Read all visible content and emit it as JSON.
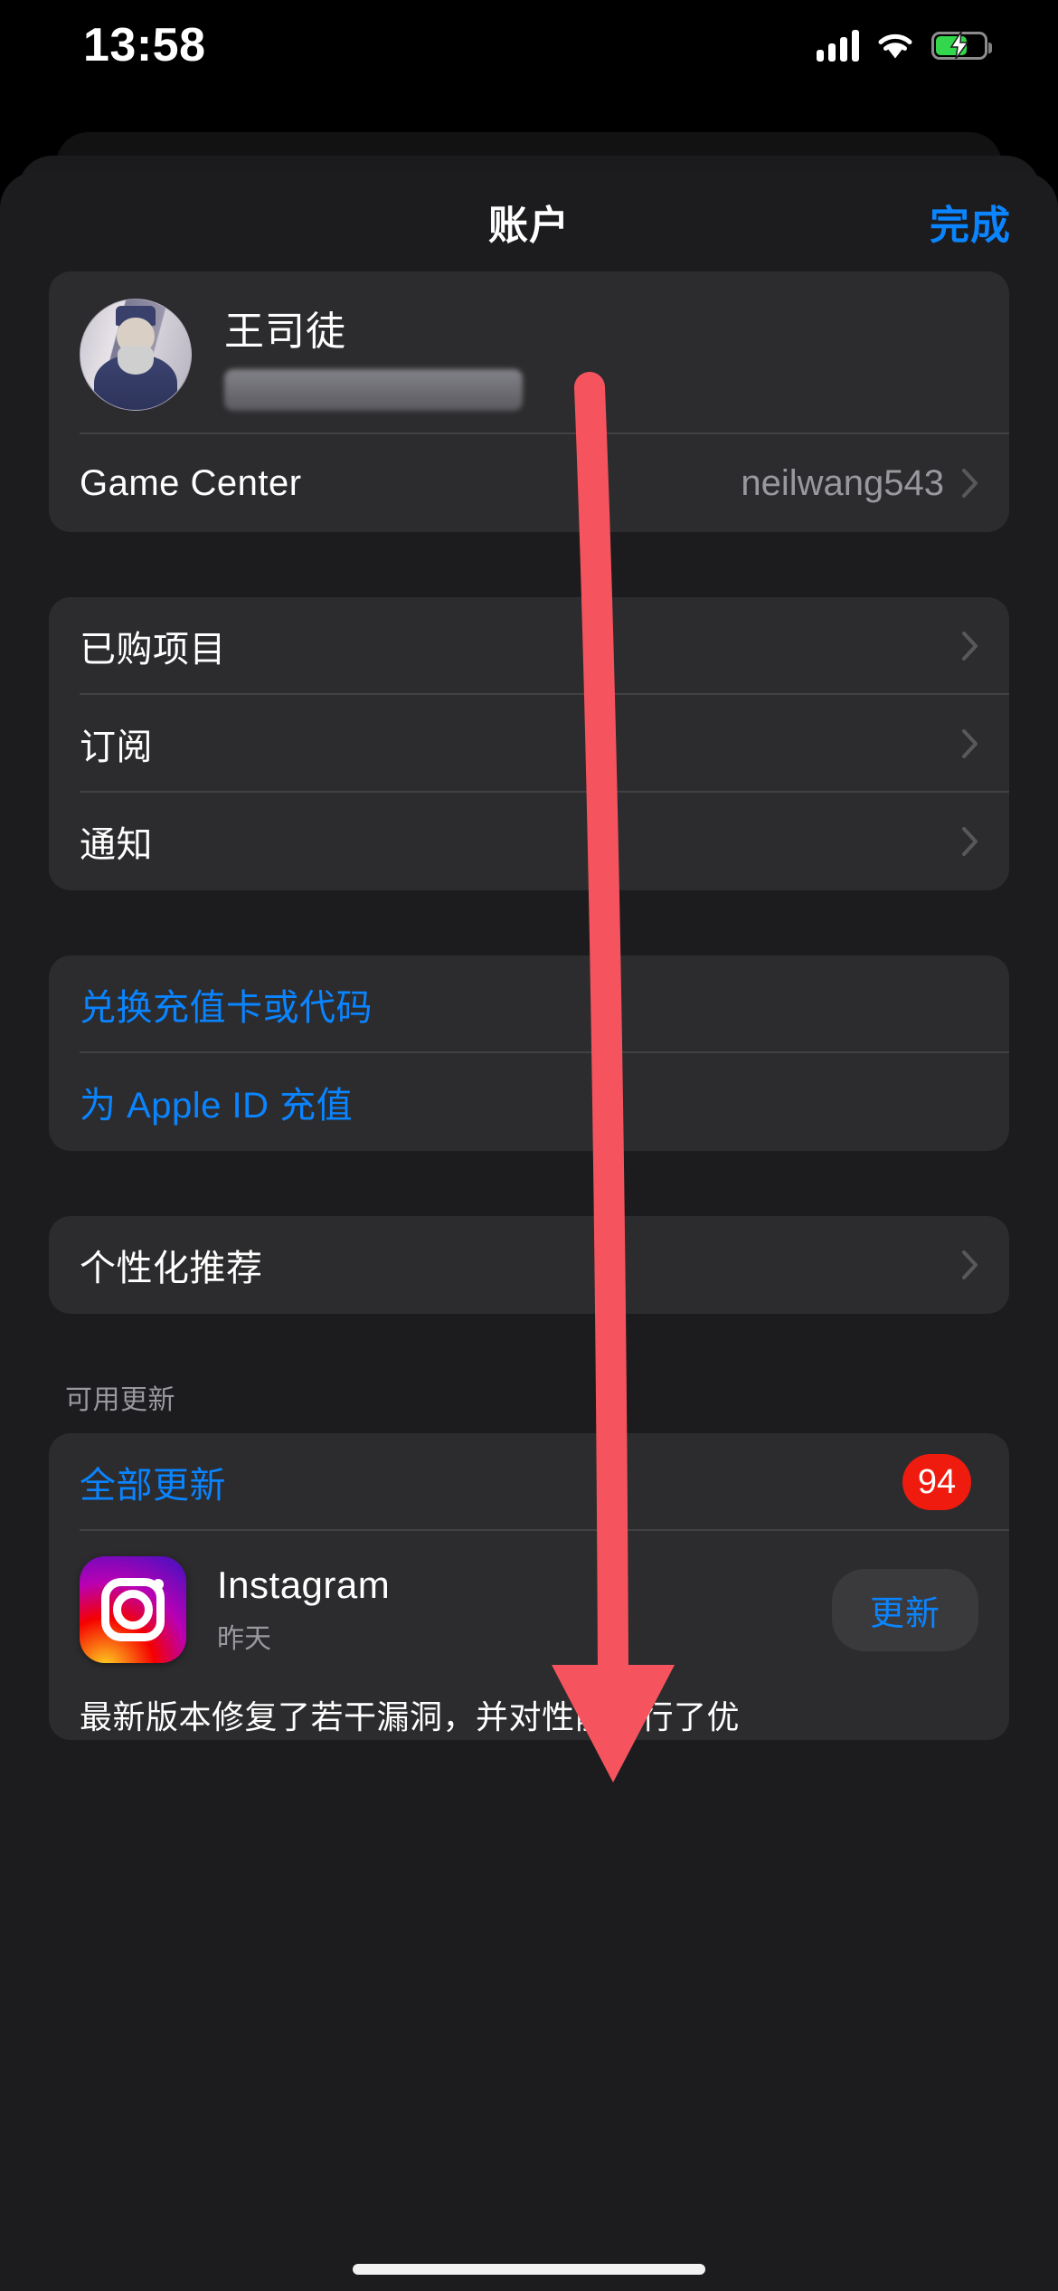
{
  "status_bar": {
    "time": "13:58",
    "cellular_icon": "cellular-bars-icon",
    "wifi_icon": "wifi-icon",
    "battery_icon": "battery-charging-icon",
    "battery_color": "#32D74B"
  },
  "nav": {
    "title": "账户",
    "done_label": "完成"
  },
  "profile": {
    "name": "王司徒",
    "email_redacted": true,
    "avatar_name": "user-avatar",
    "game_center": {
      "label": "Game Center",
      "value": "neilwang543"
    }
  },
  "account_menu": {
    "items": [
      {
        "label": "已购项目"
      },
      {
        "label": "订阅"
      },
      {
        "label": "通知"
      }
    ]
  },
  "redeem_menu": {
    "items": [
      {
        "label": "兑换充值卡或代码"
      },
      {
        "label": "为 Apple ID 充值"
      }
    ]
  },
  "personalization": {
    "items": [
      {
        "label": "个性化推荐"
      }
    ]
  },
  "updates": {
    "section_header": "可用更新",
    "update_all_label": "全部更新",
    "badge_count": "94",
    "badge_color": "#F01B0F",
    "apps": [
      {
        "name": "Instagram",
        "subtitle": "昨天",
        "button_label": "更新",
        "notes": "最新版本修复了若干漏洞，并对性能进行了优"
      }
    ]
  },
  "annotation": {
    "type": "arrow",
    "color": "#F5545E",
    "points_to": "updates-badge"
  },
  "theme": {
    "accent_blue": "#0A84FF",
    "card_bg": "#2c2c2e",
    "sheet_bg": "#1c1c1e",
    "secondary_text": "#98989f"
  }
}
